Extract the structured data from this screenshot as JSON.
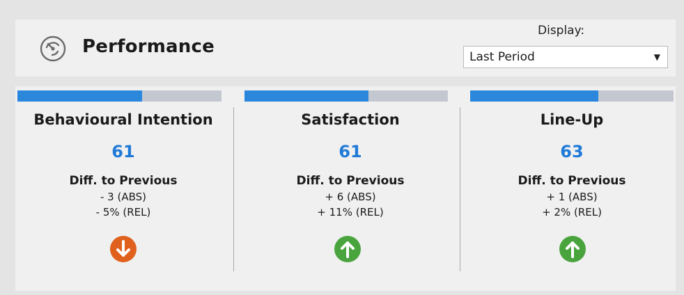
{
  "header": {
    "title": "Performance",
    "icon": "speedometer-icon",
    "display_label": "Display:",
    "display_value": "Last Period"
  },
  "colors": {
    "bar_fill": "#2a87dc",
    "bar_track": "#c3c8d0",
    "score": "#1f7ad8",
    "down": "#e0601e",
    "up": "#4aa43e"
  },
  "cards": [
    {
      "title": "Behavioural Intention",
      "score": "61",
      "score_fraction": 0.61,
      "diff_title": "Diff. to Previous",
      "abs": "- 3 (ABS)",
      "rel": "- 5% (REL)",
      "trend": "down",
      "trend_icon": "arrow-down-circle-icon"
    },
    {
      "title": "Satisfaction",
      "score": "61",
      "score_fraction": 0.61,
      "diff_title": "Diff. to Previous",
      "abs": "+ 6 (ABS)",
      "rel": "+ 11% (REL)",
      "trend": "up",
      "trend_icon": "arrow-up-circle-icon"
    },
    {
      "title": "Line-Up",
      "score": "63",
      "score_fraction": 0.63,
      "diff_title": "Diff. to Previous",
      "abs": "+ 1 (ABS)",
      "rel": "+ 2% (REL)",
      "trend": "up",
      "trend_icon": "arrow-up-circle-icon"
    }
  ]
}
